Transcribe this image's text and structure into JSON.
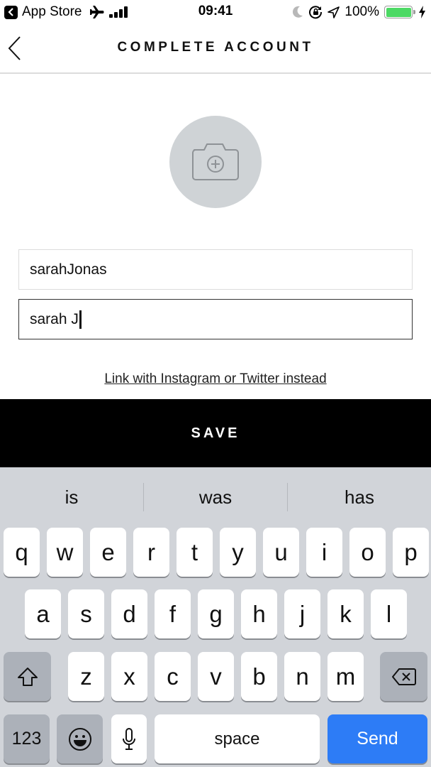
{
  "status_bar": {
    "back_app": "App Store",
    "time": "09:41",
    "battery_percent_label": "100%",
    "battery_level": 1.0,
    "battery_color": "#4cd964",
    "icons": [
      "airplane-icon",
      "signal-icon",
      "moon-icon",
      "rotation-lock-icon",
      "location-icon",
      "battery-icon",
      "charging-icon"
    ]
  },
  "nav": {
    "title": "COMPLETE ACCOUNT",
    "back_icon": "chevron-left-icon"
  },
  "avatar": {
    "icon": "camera-add-icon",
    "background": "#cfd3d6"
  },
  "form": {
    "username_value": "sarahJonas",
    "name_value": "sarah J",
    "alt_link": "Link with Instagram or Twitter instead",
    "save_label": "SAVE"
  },
  "keyboard": {
    "suggestions": [
      "is",
      "was",
      "has"
    ],
    "row1": [
      "q",
      "w",
      "e",
      "r",
      "t",
      "y",
      "u",
      "i",
      "o",
      "p"
    ],
    "row2": [
      "a",
      "s",
      "d",
      "f",
      "g",
      "h",
      "j",
      "k",
      "l"
    ],
    "row3": [
      "z",
      "x",
      "c",
      "v",
      "b",
      "n",
      "m"
    ],
    "numbers_label": "123",
    "space_label": "space",
    "send_label": "Send",
    "send_color": "#2d7cf6"
  }
}
